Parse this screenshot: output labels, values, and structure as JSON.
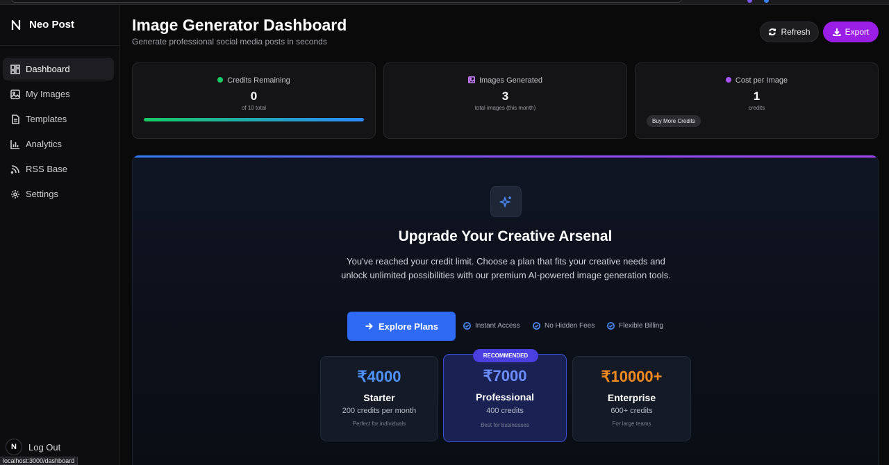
{
  "brand": {
    "name": "Neo Post"
  },
  "nav": {
    "items": [
      {
        "label": "Dashboard",
        "icon": "dashboard-grid-icon",
        "active": true
      },
      {
        "label": "My Images",
        "icon": "image-icon",
        "active": false
      },
      {
        "label": "Templates",
        "icon": "document-icon",
        "active": false
      },
      {
        "label": "Analytics",
        "icon": "bar-chart-icon",
        "active": false
      },
      {
        "label": "RSS Base",
        "icon": "rss-icon",
        "active": false
      },
      {
        "label": "Settings",
        "icon": "gear-icon",
        "active": false
      }
    ],
    "logout_label": "Log Out",
    "avatar_letter": "N"
  },
  "status_url": "localhost:3000/dashboard",
  "header": {
    "title": "Image Generator Dashboard",
    "subtitle": "Generate professional social media posts in seconds",
    "refresh_label": "Refresh",
    "export_label": "Export"
  },
  "stats": {
    "credits": {
      "label": "Credits Remaining",
      "value": "0",
      "sub": "of 10 total",
      "dot_color": "#18c964",
      "progress": 1.0
    },
    "images": {
      "label": "Images Generated",
      "value": "3",
      "sub": "total images (this month)"
    },
    "cost": {
      "label": "Cost per Image",
      "value": "1",
      "sub": "credits",
      "dot_color": "#a855f7",
      "button": "Buy More Credits"
    }
  },
  "upgrade": {
    "title": "Upgrade Your Creative Arsenal",
    "description": "You've reached your credit limit. Choose a plan that fits your creative needs and unlock unlimited possibilities with our premium AI-powered image generation tools.",
    "cta": "Explore Plans",
    "features": [
      "Instant Access",
      "No Hidden Fees",
      "Flexible Billing"
    ],
    "badge": "RECOMMENDED",
    "plans": [
      {
        "price": "₹4000",
        "name": "Starter",
        "credits": "200 credits per month",
        "note": "Perfect for individuals",
        "color": "#4f93ff"
      },
      {
        "price": "₹7000",
        "name": "Professional",
        "credits": "400 credits",
        "note": "Best for businesses",
        "color": "#6b8dff"
      },
      {
        "price": "₹10000+",
        "name": "Enterprise",
        "credits": "600+ credits",
        "note": "For large teams",
        "color": "#f58a1f"
      }
    ]
  },
  "colors": {
    "accent_purple": "#9b1ee6",
    "accent_blue": "#2f6af5"
  }
}
